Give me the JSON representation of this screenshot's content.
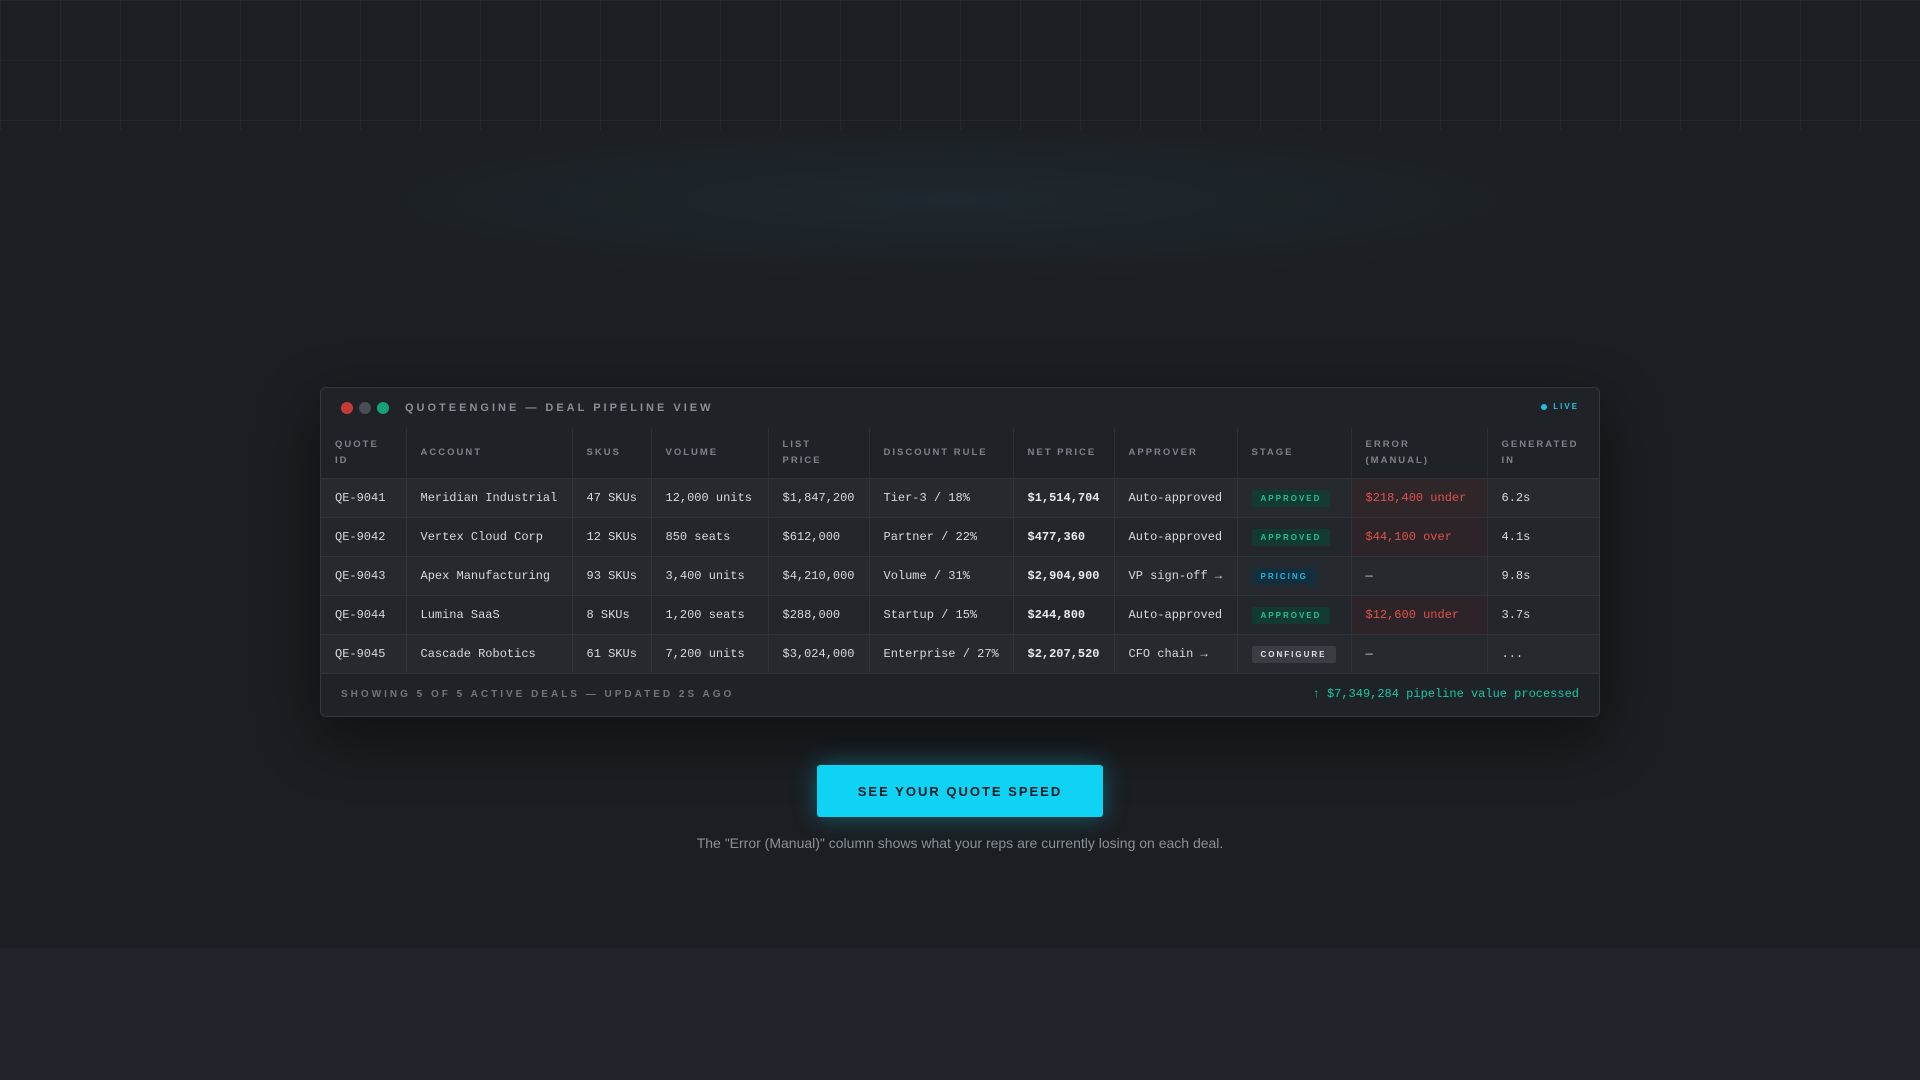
{
  "window": {
    "title": "QUOTEENGINE — DEAL PIPELINE VIEW",
    "live_label": "LIVE"
  },
  "table": {
    "columns": [
      "QUOTE ID",
      "ACCOUNT",
      "SKUS",
      "VOLUME",
      "LIST PRICE",
      "DISCOUNT RULE",
      "NET PRICE",
      "APPROVER",
      "STAGE",
      "ERROR (MANUAL)",
      "GENERATED IN"
    ],
    "rows": [
      {
        "quote_id": "QE-9041",
        "account": "Meridian Industrial",
        "skus": "47 SKUs",
        "volume": "12,000 units",
        "list_price": "$1,847,200",
        "discount_rule": "Tier-3 / 18%",
        "net_price": "$1,514,704",
        "approver": "Auto-approved",
        "stage": "APPROVED",
        "error": "$218,400 under",
        "generated": "6.2s"
      },
      {
        "quote_id": "QE-9042",
        "account": "Vertex Cloud Corp",
        "skus": "12 SKUs",
        "volume": "850 seats",
        "list_price": "$612,000",
        "discount_rule": "Partner / 22%",
        "net_price": "$477,360",
        "approver": "Auto-approved",
        "stage": "APPROVED",
        "error": "$44,100 over",
        "generated": "4.1s"
      },
      {
        "quote_id": "QE-9043",
        "account": "Apex Manufacturing",
        "skus": "93 SKUs",
        "volume": "3,400 units",
        "list_price": "$4,210,000",
        "discount_rule": "Volume / 31%",
        "net_price": "$2,904,900",
        "approver": "VP sign-off →",
        "stage": "PRICING",
        "error": "—",
        "generated": "9.8s"
      },
      {
        "quote_id": "QE-9044",
        "account": "Lumina SaaS",
        "skus": "8 SKUs",
        "volume": "1,200 seats",
        "list_price": "$288,000",
        "discount_rule": "Startup / 15%",
        "net_price": "$244,800",
        "approver": "Auto-approved",
        "stage": "APPROVED",
        "error": "$12,600 under",
        "generated": "3.7s"
      },
      {
        "quote_id": "QE-9045",
        "account": "Cascade Robotics",
        "skus": "61 SKUs",
        "volume": "7,200 units",
        "list_price": "$3,024,000",
        "discount_rule": "Enterprise / 27%",
        "net_price": "$2,207,520",
        "approver": "CFO chain →",
        "stage": "CONFIGURE",
        "error": "—",
        "generated": "..."
      }
    ]
  },
  "footer": {
    "status": "SHOWING 5 OF 5 ACTIVE DEALS — UPDATED 2S AGO",
    "pipeline": "↑ $7,349,284 pipeline value processed"
  },
  "cta": {
    "label": "SEE YOUR QUOTE SPEED",
    "note": "The \"Error (Manual)\" column shows what your reps are currently losing on each deal."
  },
  "colors": {
    "accent": "#0fd3f5",
    "approved": "#24c28e",
    "pricing": "#18b9e0",
    "error": "#e0524c",
    "live": "#16c6e0"
  }
}
